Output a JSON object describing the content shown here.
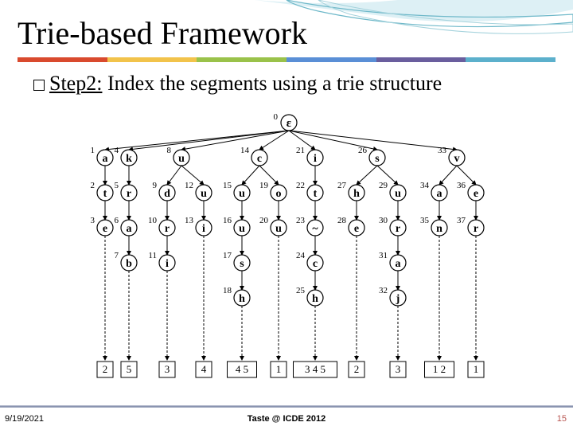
{
  "title": "Trie-based Framework",
  "subtitle_prefix": "Step2:",
  "subtitle_rest": " Index the segments using a trie structure",
  "footer": {
    "date": "9/19/2021",
    "center": "Taste @ ICDE 2012",
    "page": "15"
  },
  "color_bar": [
    "#d94a2e",
    "#f2c34b",
    "#9ac24a",
    "#5a8fd6",
    "#6a5e9e",
    "#5cb0cc"
  ],
  "trie": {
    "root": {
      "id": 0,
      "char": "ε"
    },
    "paths": [
      {
        "ids": [
          1,
          2,
          3
        ],
        "chars": [
          "a",
          "t",
          "e"
        ],
        "leaf": "2"
      },
      {
        "ids": [
          4,
          5,
          6,
          7
        ],
        "chars": [
          "k",
          "r",
          "a",
          "b"
        ],
        "leaf": "5"
      },
      {
        "ids": [
          8,
          9,
          10,
          11
        ],
        "chars": [
          "u",
          "d",
          "r",
          "i"
        ],
        "leaf": "3"
      },
      {
        "ids": [
          12,
          13
        ],
        "chars": [
          "u",
          "i"
        ],
        "leaf": "4"
      },
      {
        "ids": [
          14,
          15,
          16,
          17,
          18
        ],
        "chars": [
          "c",
          "u",
          "u",
          "s",
          "h"
        ],
        "leaf": "4 5"
      },
      {
        "ids": [
          19,
          20
        ],
        "chars": [
          "o",
          "u"
        ],
        "leaf": "1"
      },
      {
        "ids": [
          21,
          22,
          23,
          24,
          25
        ],
        "chars": [
          "i",
          "t",
          "~",
          "c",
          "h"
        ],
        "leaf": "3 4 5"
      },
      {
        "ids": [
          26,
          27,
          28
        ],
        "chars": [
          "s",
          "h",
          "e"
        ],
        "leaf": "2"
      },
      {
        "ids": [
          29,
          30,
          31,
          32
        ],
        "chars": [
          "u",
          "r",
          "a",
          "j"
        ],
        "leaf": "3"
      },
      {
        "ids": [
          33,
          34,
          35
        ],
        "chars": [
          "v",
          "a",
          "n"
        ],
        "leaf": "1 2"
      },
      {
        "ids": [
          36,
          37
        ],
        "chars": [
          "e",
          "r"
        ],
        "leaf": "1"
      }
    ]
  }
}
